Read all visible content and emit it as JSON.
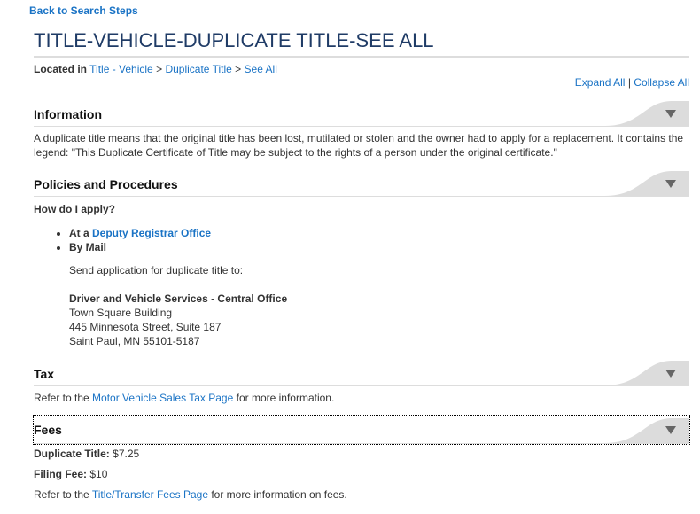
{
  "back_link": "Back to Search Steps",
  "page_title": "TITLE-VEHICLE-DUPLICATE TITLE-SEE ALL",
  "breadcrumb": {
    "prefix": "Located in",
    "items": [
      "Title - Vehicle",
      "Duplicate Title",
      "See All"
    ],
    "separator": ">"
  },
  "expand_all": "Expand All",
  "divider": "|",
  "collapse_all": "Collapse All",
  "sections": {
    "information": {
      "title": "Information",
      "body": "A duplicate title means that the original title has been lost, mutilated or stolen and the owner had to apply for a replacement. It contains the legend: \"This Duplicate Certificate of Title may be subject to the rights of a person under the original certificate.\""
    },
    "policies": {
      "title": "Policies and Procedures",
      "question": "How do I apply?",
      "item1_prefix": "At a",
      "item1_link": "Deputy Registrar Office",
      "item2": "By Mail",
      "send": "Send application for duplicate title to:",
      "addr_name": "Driver and Vehicle Services - Central Office",
      "addr1": "Town Square Building",
      "addr2": "445 Minnesota Street, Suite 187",
      "addr3": "Saint Paul, MN 55101-5187"
    },
    "tax": {
      "title": "Tax",
      "pre": "Refer to the",
      "link": "Motor Vehicle Sales Tax Page",
      "post": "for more information."
    },
    "fees": {
      "title": "Fees",
      "dup_label": "Duplicate Title:",
      "dup_value": "$7.25",
      "filing_label": "Filing Fee:",
      "filing_value": "$10",
      "pre": "Refer to the",
      "link": "Title/Transfer Fees Page",
      "post": "for more information on fees."
    }
  },
  "colors": {
    "link": "#1a73c5",
    "title": "#1f3b66",
    "header_tab": "#dcdcdc"
  }
}
